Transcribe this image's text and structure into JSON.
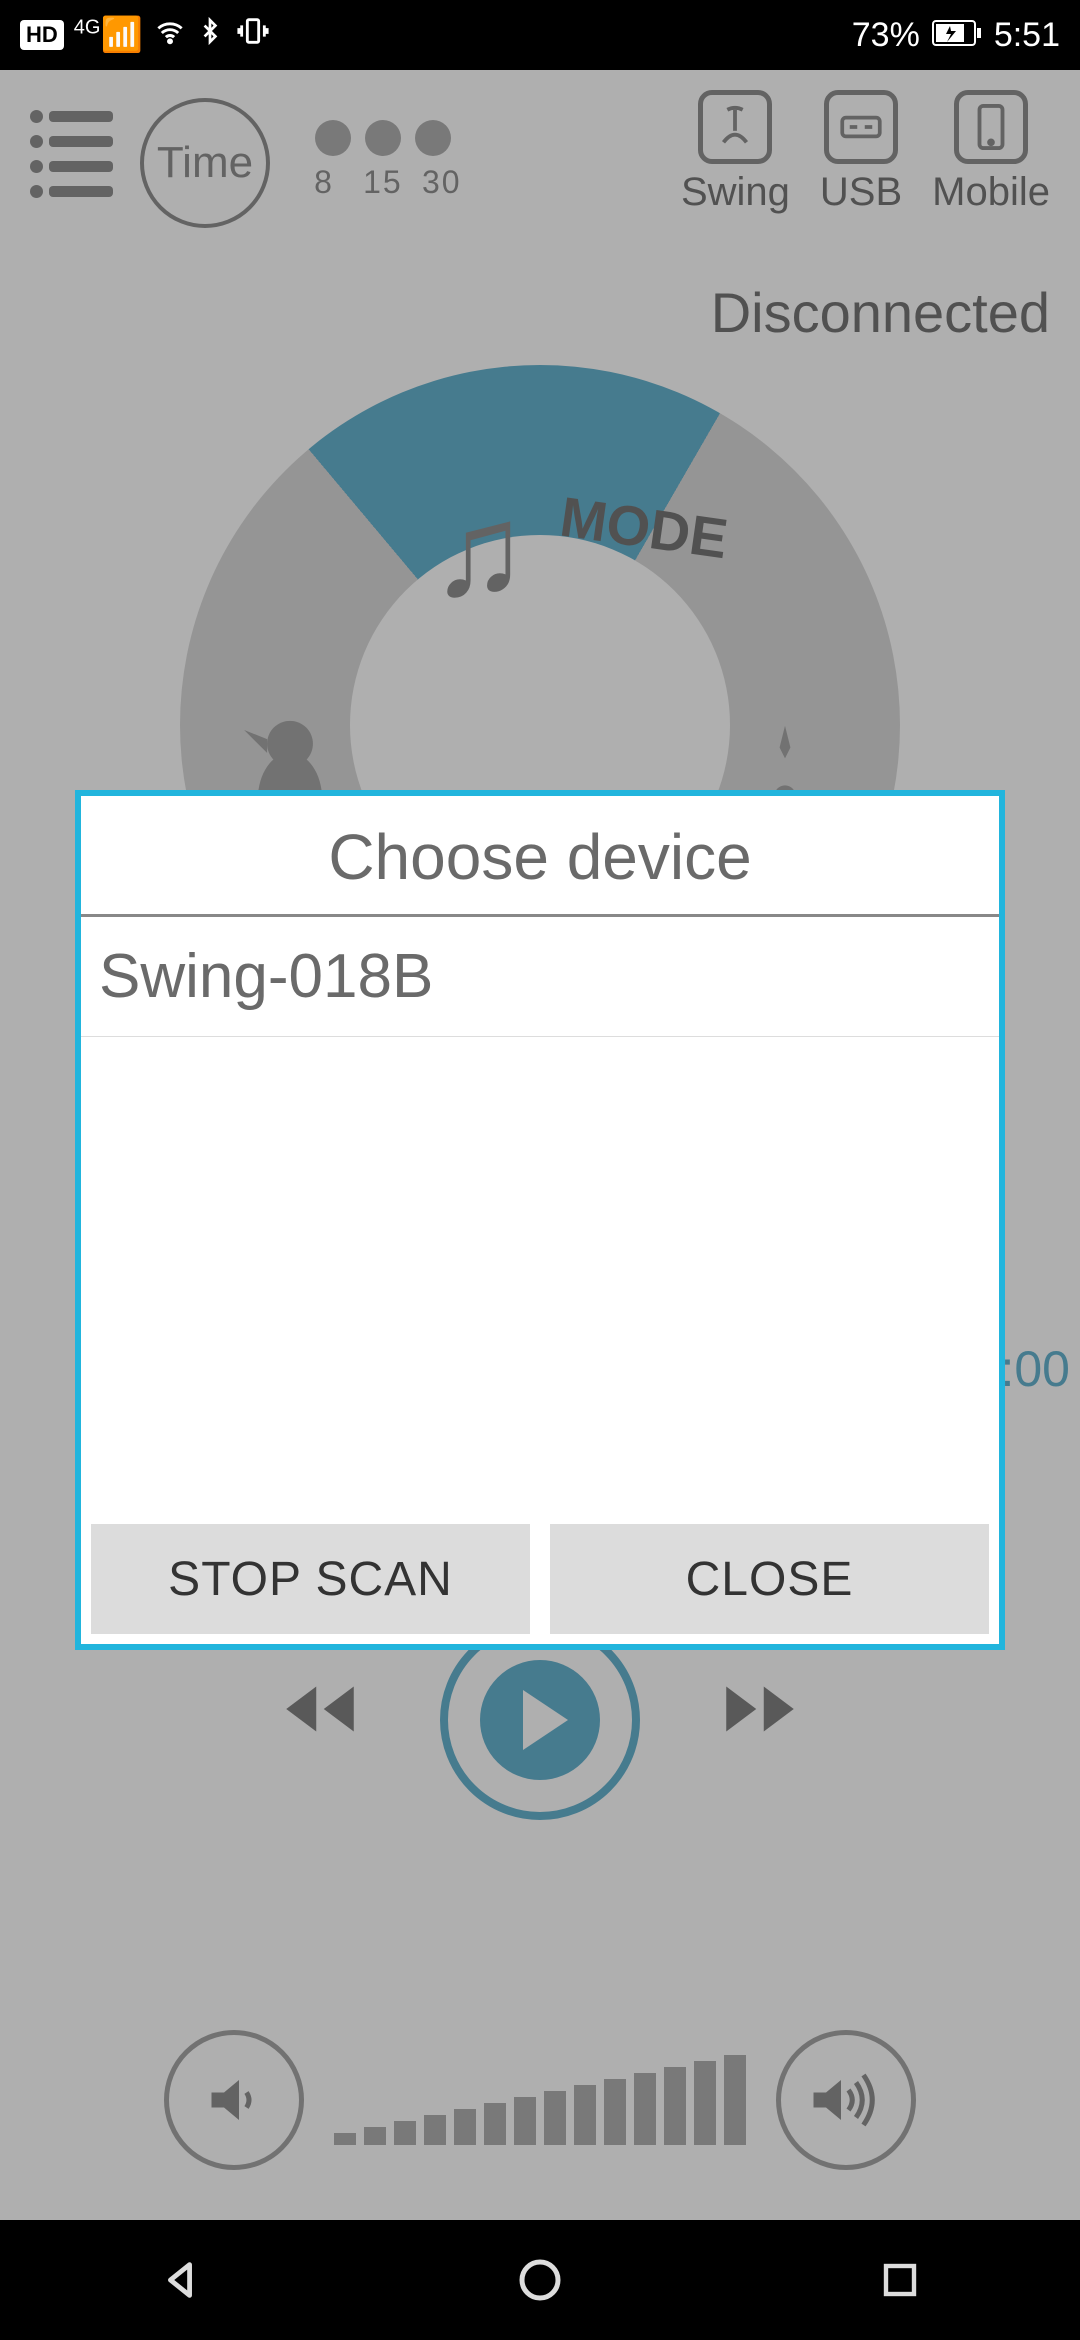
{
  "status_bar": {
    "hd": "HD",
    "net": "4G",
    "battery_pct": "73%",
    "time": "5:51"
  },
  "top_bar": {
    "time_label": "Time",
    "timer_values": [
      "8",
      "15",
      "30"
    ],
    "modes": {
      "swing": "Swing",
      "usb": "USB",
      "mobile": "Mobile"
    }
  },
  "connection_status": "Disconnected",
  "wheel": {
    "mode_label": "MODE"
  },
  "time_readout": ":00",
  "dialog": {
    "title": "Choose device",
    "devices": [
      "Swing-018B"
    ],
    "stop_scan": "STOP SCAN",
    "close": "CLOSE"
  }
}
